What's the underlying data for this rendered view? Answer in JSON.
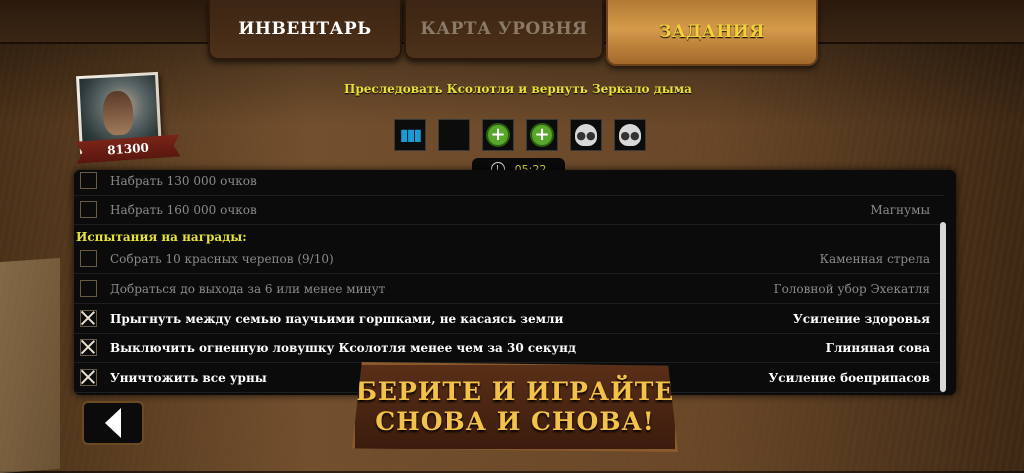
{
  "tabs": [
    {
      "label": "ИНВЕНТАРЬ",
      "active": false
    },
    {
      "label": "КАРТА УРОВНЯ",
      "active": false
    },
    {
      "label": "ЗАДАНИЯ",
      "active": true
    }
  ],
  "player": {
    "score": "81300"
  },
  "objective": "Преследовать Ксолотля и вернуть Зеркало дыма",
  "reward_icons": [
    "ammo-icon",
    "empty-slot",
    "health-plus-icon",
    "health-plus-icon",
    "skull-icon",
    "skull-icon"
  ],
  "timer": "05:22",
  "challenges": {
    "score_rows": [
      {
        "label": "Набрать 130 000 очков",
        "reward": "",
        "done": false
      },
      {
        "label": "Набрать 160 000 очков",
        "reward": "Магнумы",
        "done": false
      }
    ],
    "section_title": "Испытания на награды:",
    "reward_rows": [
      {
        "label": "Собрать 10 красных черепов (9/10)",
        "reward": "Каменная стрела",
        "done": false
      },
      {
        "label": "Добраться до выхода за 6 или менее минут",
        "reward": "Головной убор Эхекатля",
        "done": false
      },
      {
        "label": "Прыгнуть между семью паучьими горшками, не касаясь земли",
        "reward": "Усиление здоровья",
        "done": true
      },
      {
        "label": "Выключить огненную ловушку Ксолотля менее чем за 30 секунд",
        "reward": "Глиняная сова",
        "done": true
      },
      {
        "label": "Уничтожить все урны",
        "reward": "Усиление боеприпасов",
        "done": true
      }
    ]
  },
  "promo": {
    "line1": "БЕРИТЕ И ИГРАЙТЕ",
    "line2": "СНОВА И СНОВА!"
  },
  "colors": {
    "accent_yellow": "#e6e23a",
    "tab_active": "#d59a4a",
    "promo_text": "#f2c24a"
  }
}
